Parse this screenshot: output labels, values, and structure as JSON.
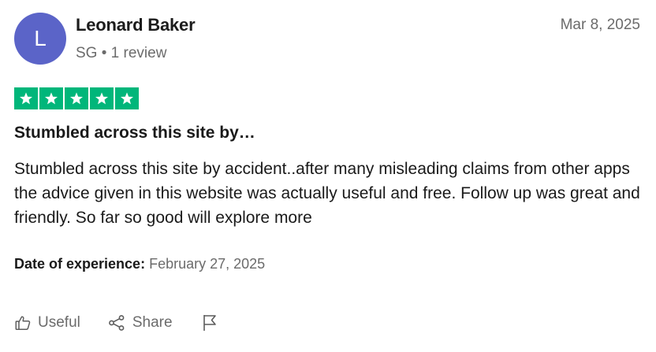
{
  "reviewer": {
    "initial": "L",
    "name": "Leonard Baker",
    "meta": "SG • 1 review",
    "avatar_color": "#5b64c8"
  },
  "review": {
    "date": "Mar 8, 2025",
    "rating": 5,
    "rating_max": 5,
    "star_color": "#00b67a",
    "title": "Stumbled across this site by…",
    "body": "Stumbled across this site by accident..after many misleading claims from other apps the advice given in this website was actually useful and free. Follow up was great and friendly. So far so good will explore more",
    "experience_label": "Date of experience:",
    "experience_date": "February 27, 2025"
  },
  "actions": {
    "useful_label": "Useful",
    "useful_icon": "thumbs-up-icon",
    "share_label": "Share",
    "share_icon": "share-icon",
    "flag_icon": "flag-icon"
  }
}
